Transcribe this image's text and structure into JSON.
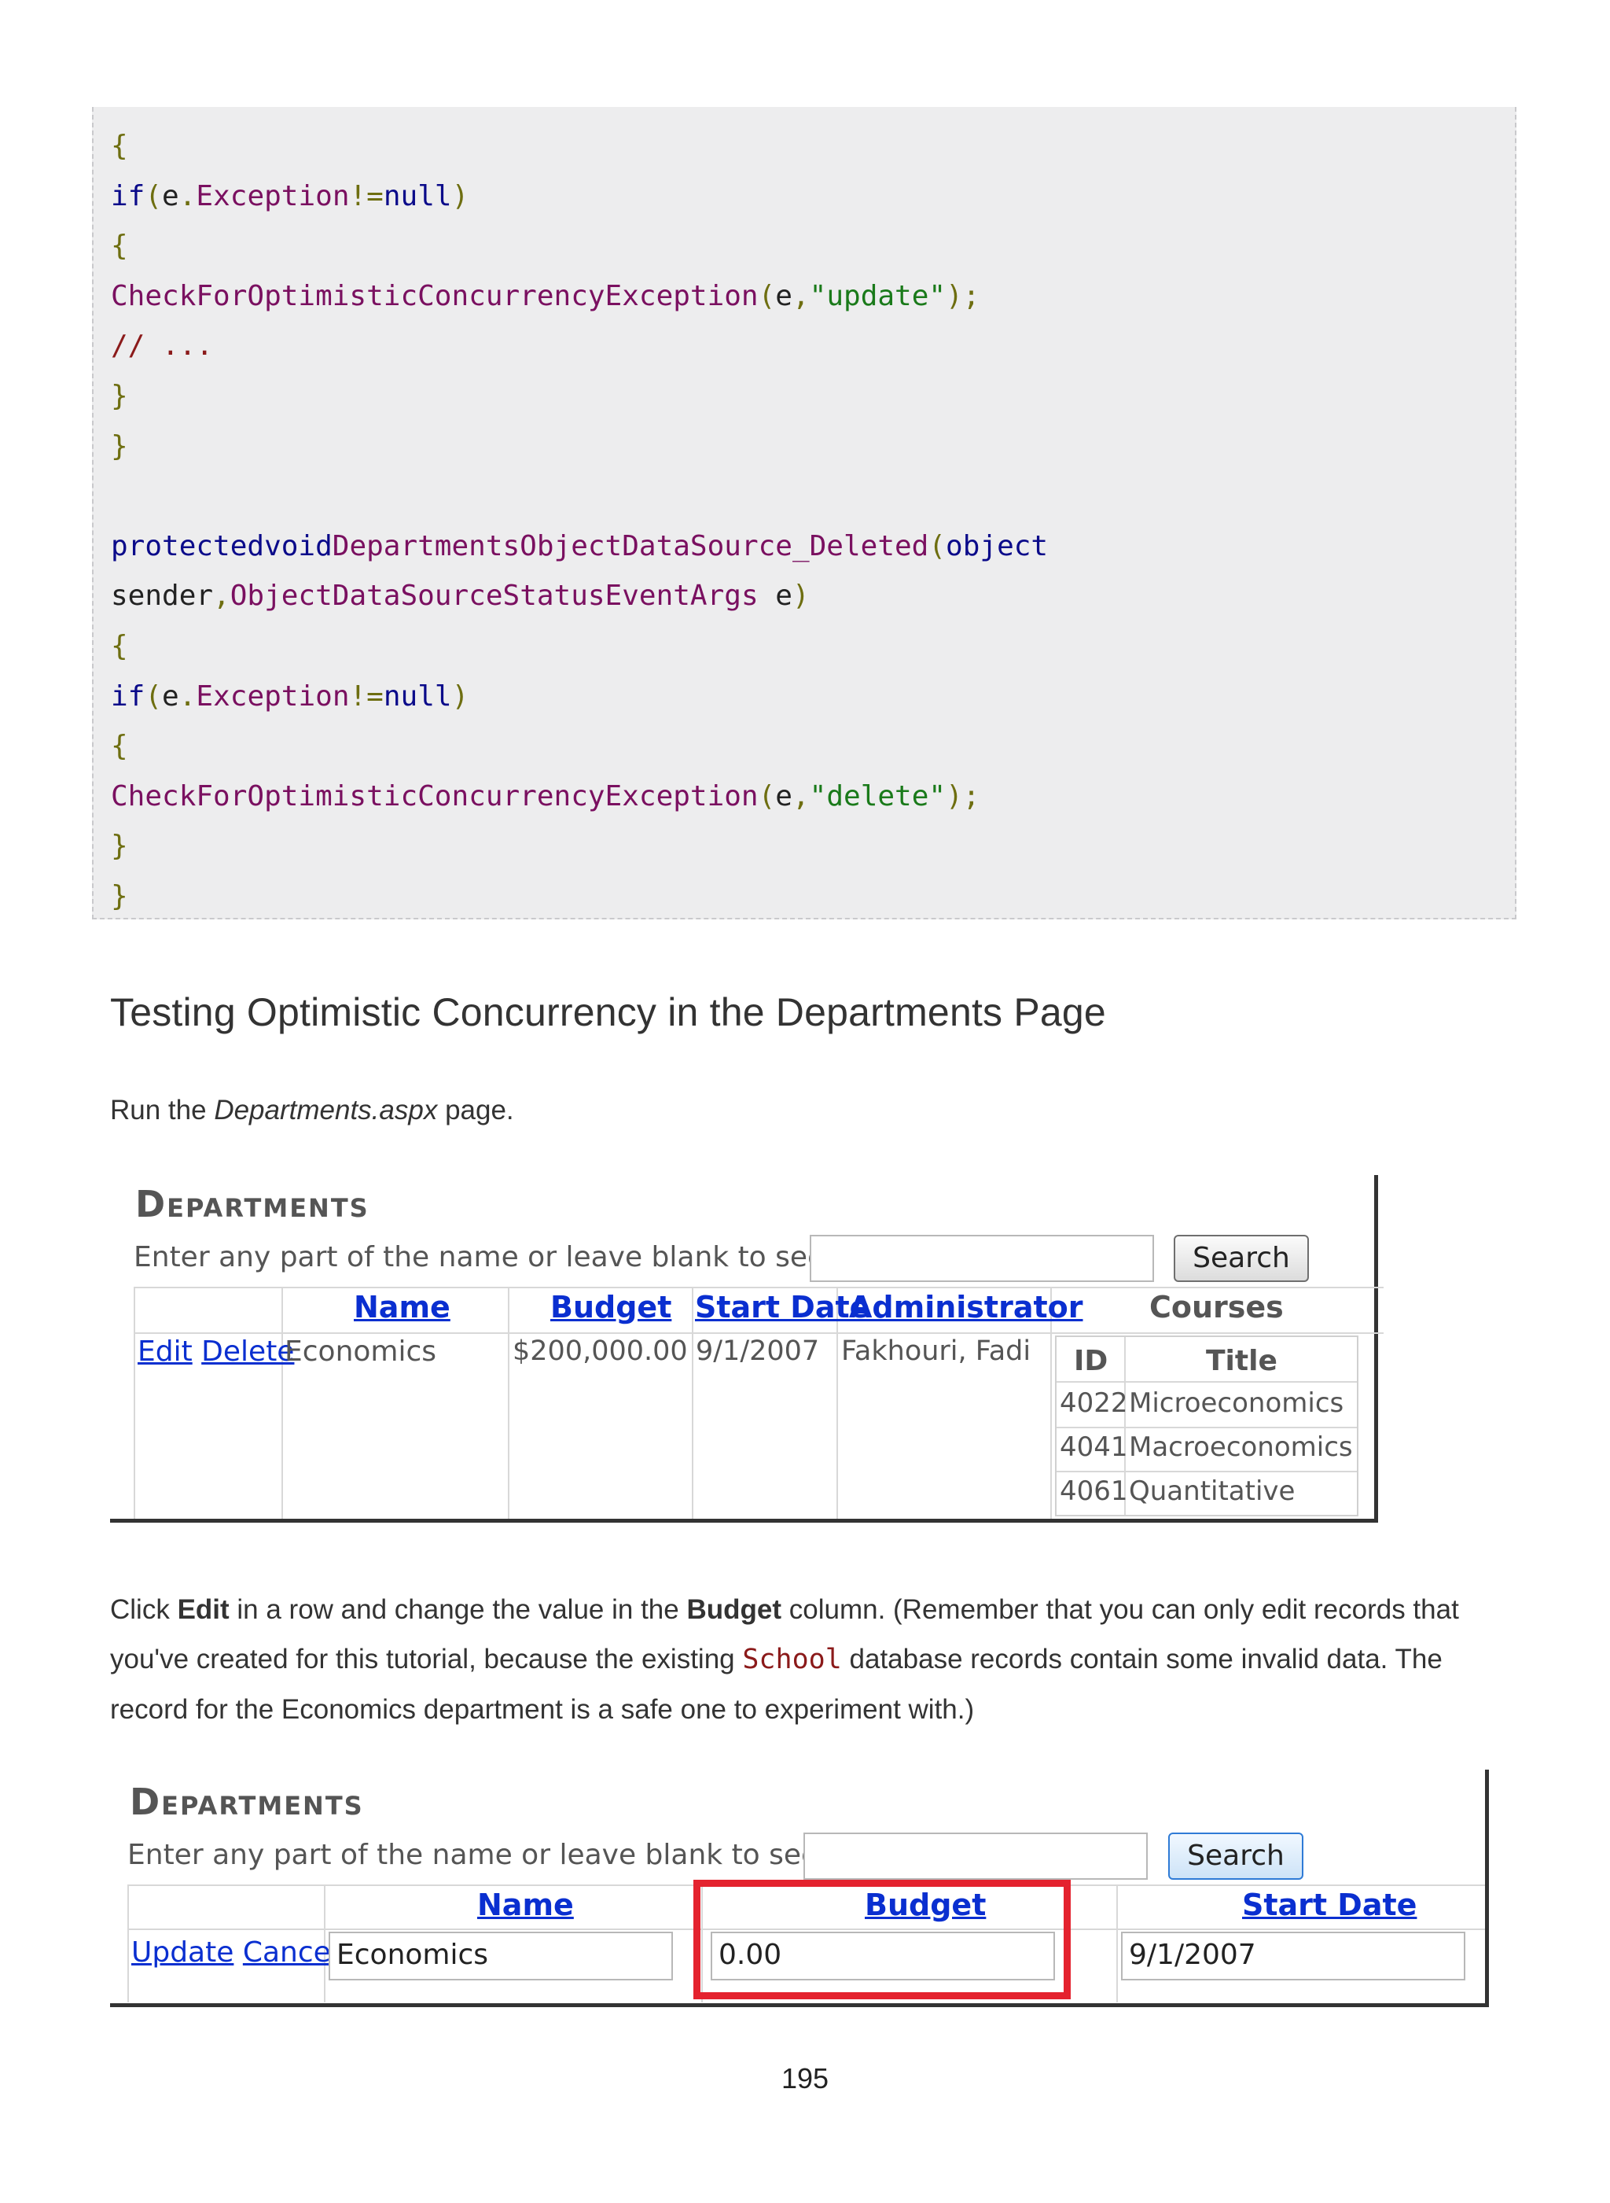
{
  "code": {
    "lines": [
      [
        {
          "t": "{",
          "c": "punc"
        }
      ],
      [
        {
          "t": "if",
          "c": "kw"
        },
        {
          "t": "(",
          "c": "punc"
        },
        {
          "t": "e",
          "c": "plain"
        },
        {
          "t": ".",
          "c": "punc"
        },
        {
          "t": "Exception",
          "c": "id"
        },
        {
          "t": "!=",
          "c": "punc"
        },
        {
          "t": "null",
          "c": "kw"
        },
        {
          "t": ")",
          "c": "punc"
        }
      ],
      [
        {
          "t": "{",
          "c": "punc"
        }
      ],
      [
        {
          "t": "CheckForOptimisticConcurrencyException",
          "c": "id"
        },
        {
          "t": "(",
          "c": "punc"
        },
        {
          "t": "e",
          "c": "plain"
        },
        {
          "t": ",",
          "c": "punc"
        },
        {
          "t": "\"update\"",
          "c": "str"
        },
        {
          "t": ");",
          "c": "punc"
        }
      ],
      [
        {
          "t": "// ...",
          "c": "cmt"
        }
      ],
      [
        {
          "t": "}",
          "c": "punc"
        }
      ],
      [
        {
          "t": "}",
          "c": "punc"
        }
      ],
      [],
      [
        {
          "t": "protectedvoid",
          "c": "kw"
        },
        {
          "t": "DepartmentsObjectDataSource_Deleted",
          "c": "id"
        },
        {
          "t": "(",
          "c": "punc"
        },
        {
          "t": "object",
          "c": "kw"
        }
      ],
      [
        {
          "t": "sender",
          "c": "plain"
        },
        {
          "t": ",",
          "c": "punc"
        },
        {
          "t": "ObjectDataSourceStatusEventArgs",
          "c": "id"
        },
        {
          "t": " e",
          "c": "plain"
        },
        {
          "t": ")",
          "c": "punc"
        }
      ],
      [
        {
          "t": "{",
          "c": "punc"
        }
      ],
      [
        {
          "t": "if",
          "c": "kw"
        },
        {
          "t": "(",
          "c": "punc"
        },
        {
          "t": "e",
          "c": "plain"
        },
        {
          "t": ".",
          "c": "punc"
        },
        {
          "t": "Exception",
          "c": "id"
        },
        {
          "t": "!=",
          "c": "punc"
        },
        {
          "t": "null",
          "c": "kw"
        },
        {
          "t": ")",
          "c": "punc"
        }
      ],
      [
        {
          "t": "{",
          "c": "punc"
        }
      ],
      [
        {
          "t": "CheckForOptimisticConcurrencyException",
          "c": "id"
        },
        {
          "t": "(",
          "c": "punc"
        },
        {
          "t": "e",
          "c": "plain"
        },
        {
          "t": ",",
          "c": "punc"
        },
        {
          "t": "\"delete\"",
          "c": "str"
        },
        {
          "t": ");",
          "c": "punc"
        }
      ],
      [
        {
          "t": "}",
          "c": "punc"
        }
      ],
      [
        {
          "t": "}",
          "c": "punc"
        }
      ]
    ]
  },
  "heading": "Testing Optimistic Concurrency in the Departments Page",
  "para1": {
    "pre": "Run the ",
    "em": "Departments.aspx",
    "post": " page."
  },
  "shot1": {
    "title": "Departments",
    "prompt": "Enter any part of the name or leave blank to see all",
    "search_button": "Search",
    "headers": {
      "name": "Name",
      "budget": "Budget",
      "start_date": "Start Date",
      "administrator": "Administrator",
      "courses": "Courses"
    },
    "row": {
      "edit": "Edit",
      "delete": "Delete",
      "name": "Economics",
      "budget": "$200,000.00",
      "start_date": "9/1/2007",
      "administrator": "Fakhouri, Fadi"
    },
    "courses": {
      "headers": {
        "id": "ID",
        "title": "Title"
      },
      "rows": [
        {
          "id": "4022",
          "title": "Microeconomics"
        },
        {
          "id": "4041",
          "title": "Macroeconomics"
        },
        {
          "id": "4061",
          "title": "Quantitative"
        }
      ]
    }
  },
  "para2": {
    "t1": "Click ",
    "b1": "Edit",
    "t2": " in a row and change the value in the ",
    "b2": "Budget",
    "t3": " column. (Remember that you can only edit records that you've created for this tutorial, because the existing ",
    "code": "School",
    "t4": " database records contain some invalid data. The record for the Economics department is a safe one to experiment with.)"
  },
  "shot2": {
    "title": "Departments",
    "prompt": "Enter any part of the name or leave blank to see all",
    "search_button": "Search",
    "headers": {
      "name": "Name",
      "budget": "Budget",
      "start_date": "Start Date"
    },
    "row": {
      "update": "Update",
      "cancel": "Cancel",
      "name": "Economics",
      "budget": "0.00",
      "start_date": "9/1/2007"
    },
    "highlight_color": "#e4222e"
  },
  "page_number": "195"
}
